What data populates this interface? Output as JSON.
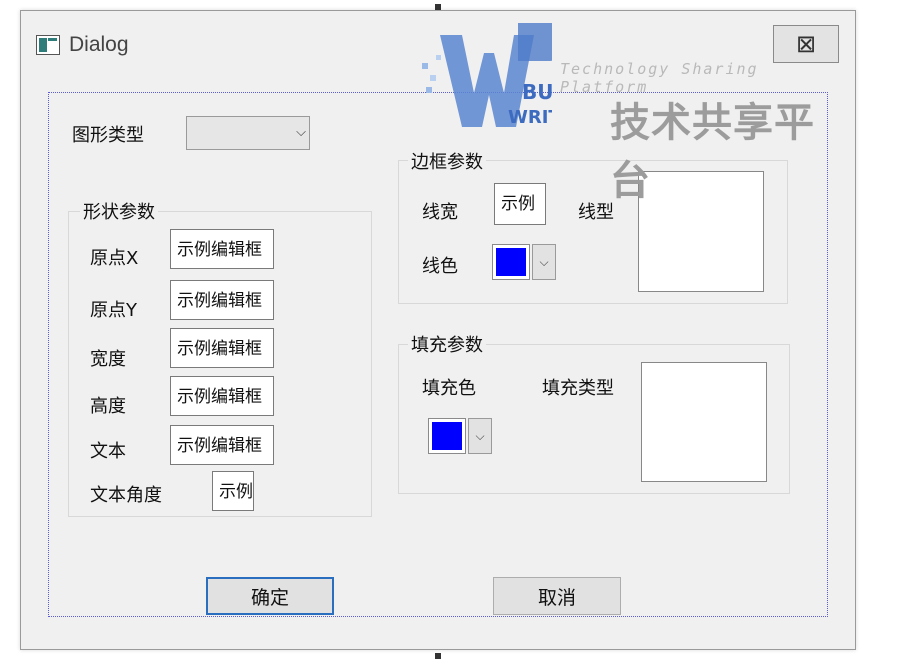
{
  "window": {
    "title": "Dialog",
    "close_glyph": "⊠"
  },
  "shape_type": {
    "label": "图形类型",
    "value": ""
  },
  "shape_group": {
    "title": "形状参数",
    "fields": [
      {
        "label": "原点X",
        "value": "示例编辑框"
      },
      {
        "label": "原点Y",
        "value": "示例编辑框"
      },
      {
        "label": "宽度",
        "value": "示例编辑框"
      },
      {
        "label": "高度",
        "value": "示例编辑框"
      },
      {
        "label": "文本",
        "value": "示例编辑框"
      },
      {
        "label": "文本角度",
        "value": "示例"
      }
    ]
  },
  "border_group": {
    "title": "边框参数",
    "width_label": "线宽",
    "width_value": "示例",
    "style_label": "线型",
    "color_label": "线色",
    "color": "#0000ff"
  },
  "fill_group": {
    "title": "填充参数",
    "color_label": "填充色",
    "type_label": "填充类型",
    "color": "#0000ff"
  },
  "buttons": {
    "ok": "确定",
    "cancel": "取消"
  },
  "watermark": {
    "text_en": "Technology Sharing Platform",
    "text_cn": "技术共享平台",
    "logo_big": "WB",
    "logo_small1": "BUG",
    "logo_small2": "WRITE"
  },
  "colors": {
    "accent": "#0000ff",
    "window_bg": "#f0f0f0",
    "focus_border": "#2a6fbf"
  },
  "icons": {
    "app": "dialog-app-icon",
    "close": "close-icon",
    "dropdown": "chevron-down-icon"
  }
}
